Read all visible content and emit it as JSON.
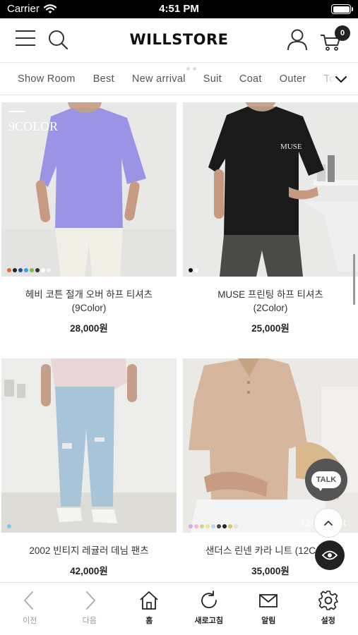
{
  "status": {
    "carrier": "Carrier",
    "time": "4:51 PM"
  },
  "header": {
    "logo": "WILLSTORE",
    "cart_count": "0"
  },
  "categories": [
    "Show Room",
    "Best",
    "New arrival",
    "Suit",
    "Coat",
    "Outer",
    "To"
  ],
  "products": [
    {
      "name_line1": "헤비 코튼 절개 오버 하프 티셔츠",
      "name_line2": "(9Color)",
      "price": "28,000원",
      "overlay_text": "9COLOR",
      "swatches": [
        "#e36d2a",
        "#222222",
        "#1f4fa0",
        "#3aa0d8",
        "#8bb54a",
        "#2e3b2c",
        "#ffffff",
        "#f3f3f3"
      ]
    },
    {
      "name_line1": "MUSE 프린팅 하프 티셔츠",
      "name_line2": "(2Color)",
      "price": "25,000원",
      "overlay_text": "MUSE",
      "swatches": [
        "#111111",
        "#ffffff"
      ]
    },
    {
      "name_line1": "2002 빈티지 레귤러 데님 팬츠",
      "name_line2": "",
      "price": "42,000원",
      "overlay_text": "",
      "swatches": [
        "#7fc7e8"
      ]
    },
    {
      "name_line1": "샌더스 린넨 카라 니트 (12C",
      "name_line2": "",
      "price": "35,000원",
      "overlay_text": "12COLOR",
      "swatches": [
        "#d9a5e8",
        "#f2b8c6",
        "#c9d88f",
        "#f4e08b",
        "#b6d9f0",
        "#444444",
        "#222222",
        "#d8c65a",
        "#e9e2d3"
      ]
    }
  ],
  "floating": {
    "talk_label": "TALK"
  },
  "tabbar": [
    {
      "label": "이전",
      "icon": "chevron-left-icon"
    },
    {
      "label": "다음",
      "icon": "chevron-right-icon"
    },
    {
      "label": "홈",
      "icon": "home-icon"
    },
    {
      "label": "새로고침",
      "icon": "refresh-icon"
    },
    {
      "label": "알림",
      "icon": "mail-icon"
    },
    {
      "label": "설정",
      "icon": "gear-icon"
    }
  ]
}
